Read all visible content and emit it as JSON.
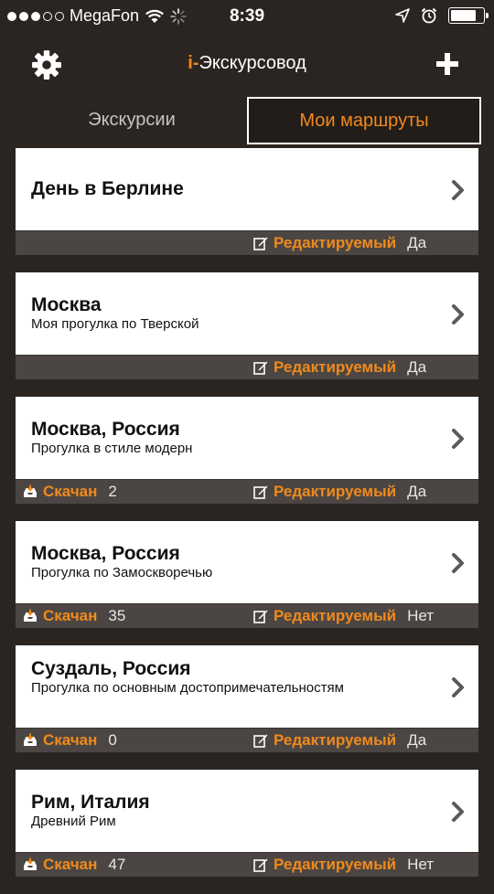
{
  "status": {
    "carrier": "MegaFon",
    "time": "8:39",
    "signal_dots": 5,
    "signal_filled": 3,
    "battery_level": 0.85
  },
  "header": {
    "title_prefix": "i-",
    "title": "Экскурсовод",
    "left_icon": "gear-icon",
    "right_icon": "plus-icon"
  },
  "tabs": [
    {
      "label": "Экскурсии",
      "active": false
    },
    {
      "label": "Мои маршруты",
      "active": true
    }
  ],
  "labels": {
    "downloaded": "Скачан",
    "editable": "Редактируемый"
  },
  "colors": {
    "accent": "#f08a1c",
    "background": "#2b2521",
    "footer": "#4b4644"
  },
  "routes": [
    {
      "title": "День в Берлине",
      "subtitle": "",
      "downloaded": "",
      "editable": "Да"
    },
    {
      "title": "Москва",
      "subtitle": "Моя прогулка по Тверской",
      "downloaded": "",
      "editable": "Да"
    },
    {
      "title": "Москва, Россия",
      "subtitle": "Прогулка в стиле модерн",
      "downloaded": "2",
      "editable": "Да"
    },
    {
      "title": "Москва, Россия",
      "subtitle": "Прогулка по Замоскворечью",
      "downloaded": "35",
      "editable": "Нет"
    },
    {
      "title": "Суздаль, Россия",
      "subtitle": "Прогулка по основным достопримечательностям",
      "downloaded": "0",
      "editable": "Да"
    },
    {
      "title": "Рим, Италия",
      "subtitle": "Древний Рим",
      "downloaded": "47",
      "editable": "Нет"
    }
  ]
}
